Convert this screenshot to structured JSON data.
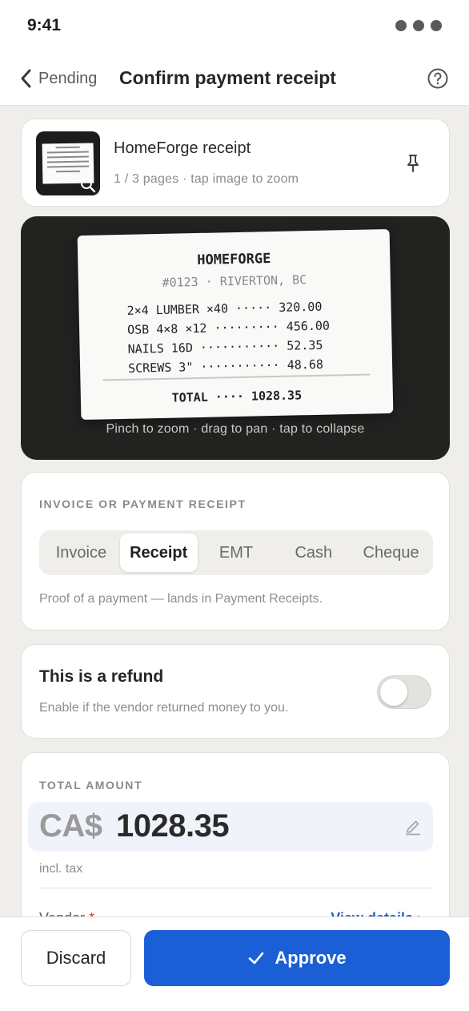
{
  "status": {
    "time": "9:41"
  },
  "nav": {
    "back_label": "Pending",
    "title": "Confirm payment receipt"
  },
  "document": {
    "title": "HomeForge receipt",
    "subtitle": "1 / 3 pages · tap image to zoom"
  },
  "receipt": {
    "store": "HOMEFORGE",
    "address": "#0123 · RIVERTON, BC",
    "lines": [
      "2×4 LUMBER ×40 ····· 320.00",
      "OSB 4×8 ×12 ········· 456.00",
      "NAILS 16D ··········· 52.35",
      "SCREWS 3\" ··········· 48.68"
    ],
    "total": "TOTAL ···· 1028.35"
  },
  "viewer": {
    "hint": "Pinch to zoom · drag to pan · tap to collapse"
  },
  "doc_type": {
    "label": "INVOICE OR PAYMENT RECEIPT",
    "options": [
      "Invoice",
      "Receipt",
      "EMT",
      "Cash",
      "Cheque"
    ],
    "selected": "Receipt",
    "hint": "Proof of a payment — lands in Payment Receipts."
  },
  "refund": {
    "title": "This is a refund",
    "subtitle": "Enable if the vendor returned money to you.",
    "enabled": false
  },
  "amount": {
    "label": "TOTAL AMOUNT",
    "currency": "CA$",
    "value": "1028.35",
    "note": "incl. tax",
    "vendor_label": "Vendor",
    "required_mark": "*",
    "view_details": "View details ›"
  },
  "actions": {
    "discard": "Discard",
    "approve": "Approve"
  },
  "colors": {
    "accent": "#1b5fd6",
    "background": "#efeeea",
    "viewer": "#222221"
  },
  "icons": [
    "chevron-left-icon",
    "help-icon",
    "pin-icon",
    "zoom-icon",
    "edit-icon",
    "check-icon"
  ]
}
